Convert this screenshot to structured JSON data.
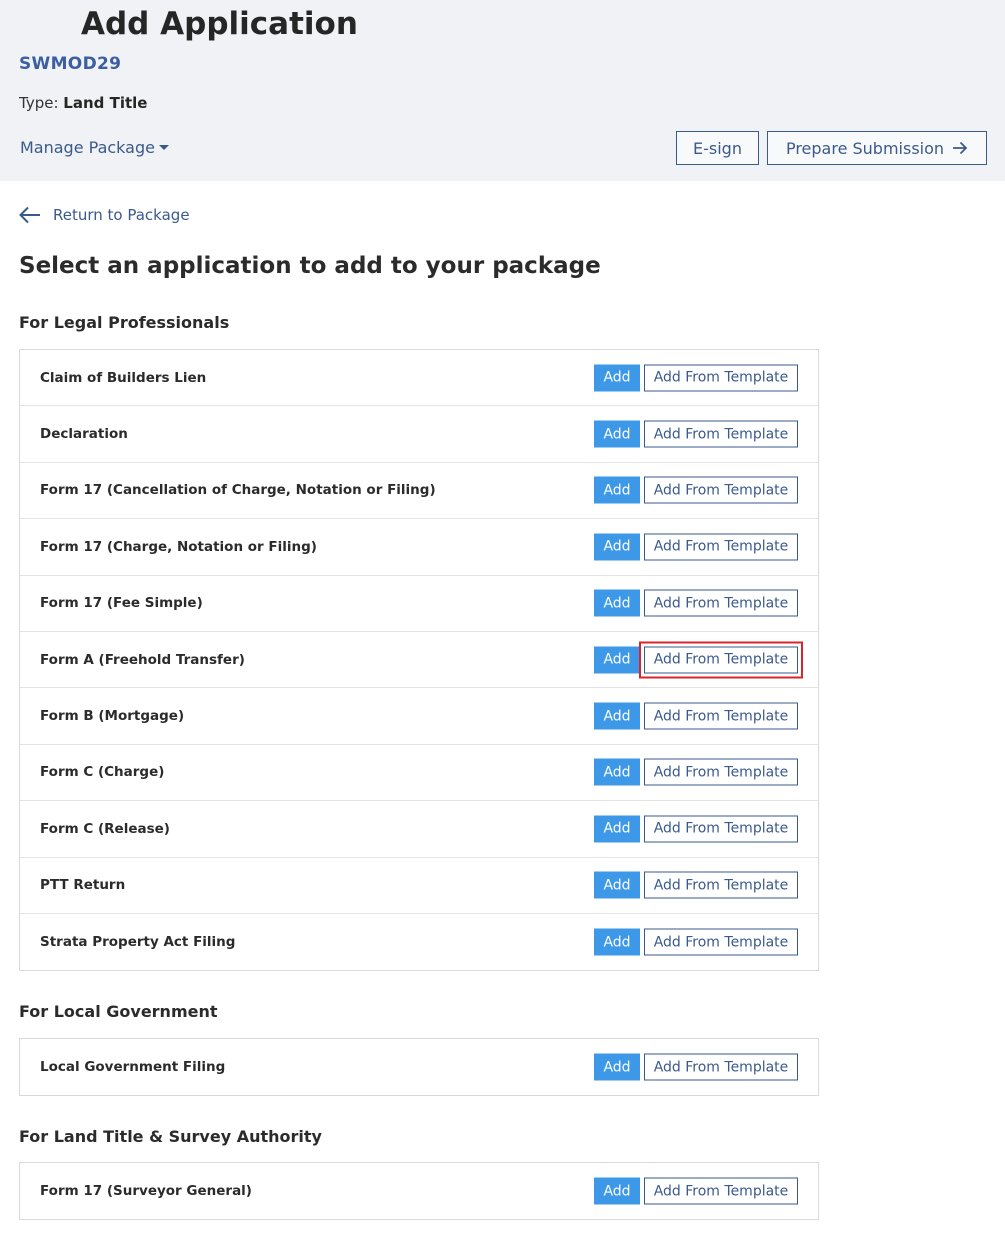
{
  "header": {
    "title": "Add Application",
    "package_id": "SWMOD29",
    "type_label": "Type:",
    "type_value": "Land Title",
    "manage_package": "Manage Package",
    "esign": "E-sign",
    "prepare_submission": "Prepare Submission"
  },
  "nav": {
    "return_to_package": "Return to Package"
  },
  "main": {
    "heading": "Select an application to add to your package",
    "add_label": "Add",
    "template_label": "Add From Template",
    "sections": [
      {
        "title": "For Legal Professionals",
        "items": [
          "Claim of Builders Lien",
          "Declaration",
          "Form 17 (Cancellation of Charge, Notation or Filing)",
          "Form 17 (Charge, Notation or Filing)",
          "Form 17 (Fee Simple)",
          "Form A (Freehold Transfer)",
          "Form B (Mortgage)",
          "Form C (Charge)",
          "Form C (Release)",
          "PTT Return",
          "Strata Property Act Filing"
        ]
      },
      {
        "title": "For Local Government",
        "items": [
          "Local Government Filing"
        ]
      },
      {
        "title": "For Land Title & Survey Authority",
        "items": [
          "Form 17 (Surveyor General)"
        ]
      }
    ],
    "highlighted_item": "Form A (Freehold Transfer)",
    "highlight_color": "#d9262c",
    "add_button_color": "#3d99e8",
    "accent_color": "#3b5a8c"
  }
}
